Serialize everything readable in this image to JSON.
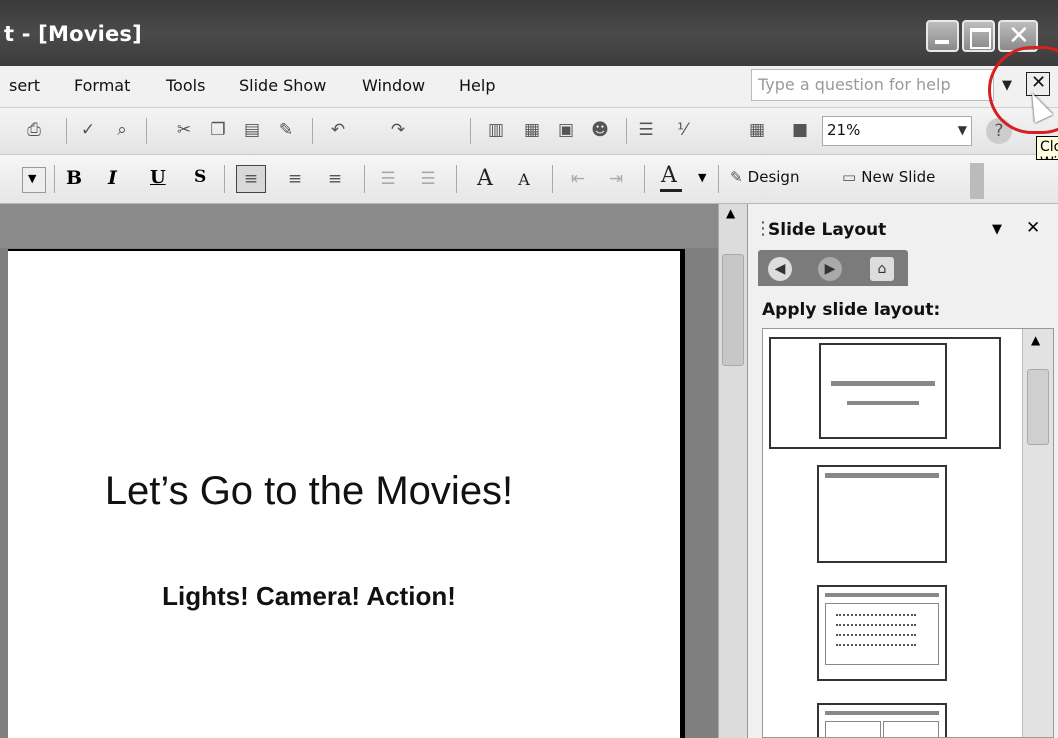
{
  "window": {
    "title": "t - [Movies]"
  },
  "menu": {
    "items": [
      "sert",
      "Format",
      "Tools",
      "Slide Show",
      "Window",
      "Help"
    ]
  },
  "help": {
    "placeholder": "Type a question for help"
  },
  "toolbar": {
    "zoom": "21%"
  },
  "formatting": {
    "bold": "B",
    "italic": "I",
    "underline": "U",
    "shadow": "S",
    "font_color": "A",
    "design_label": "Design",
    "new_slide_label": "New Slide"
  },
  "slide": {
    "title": "Let’s Go to the Movies!",
    "subtitle": "Lights! Camera! Action!"
  },
  "task_pane": {
    "title": "Slide Layout",
    "apply_label": "Apply slide layout:"
  },
  "tooltip": {
    "text": "Close Window"
  },
  "colors": {
    "titlebar": "#3c3c3c",
    "slide_bg": "#ffffff",
    "workarea": "#7f7f7f",
    "highlight_circle": "#d42020"
  },
  "icons": [
    "minimize-icon",
    "maximize-icon",
    "close-icon",
    "close-window-icon",
    "back-icon",
    "forward-icon",
    "home-icon",
    "mouse-cursor-icon"
  ]
}
